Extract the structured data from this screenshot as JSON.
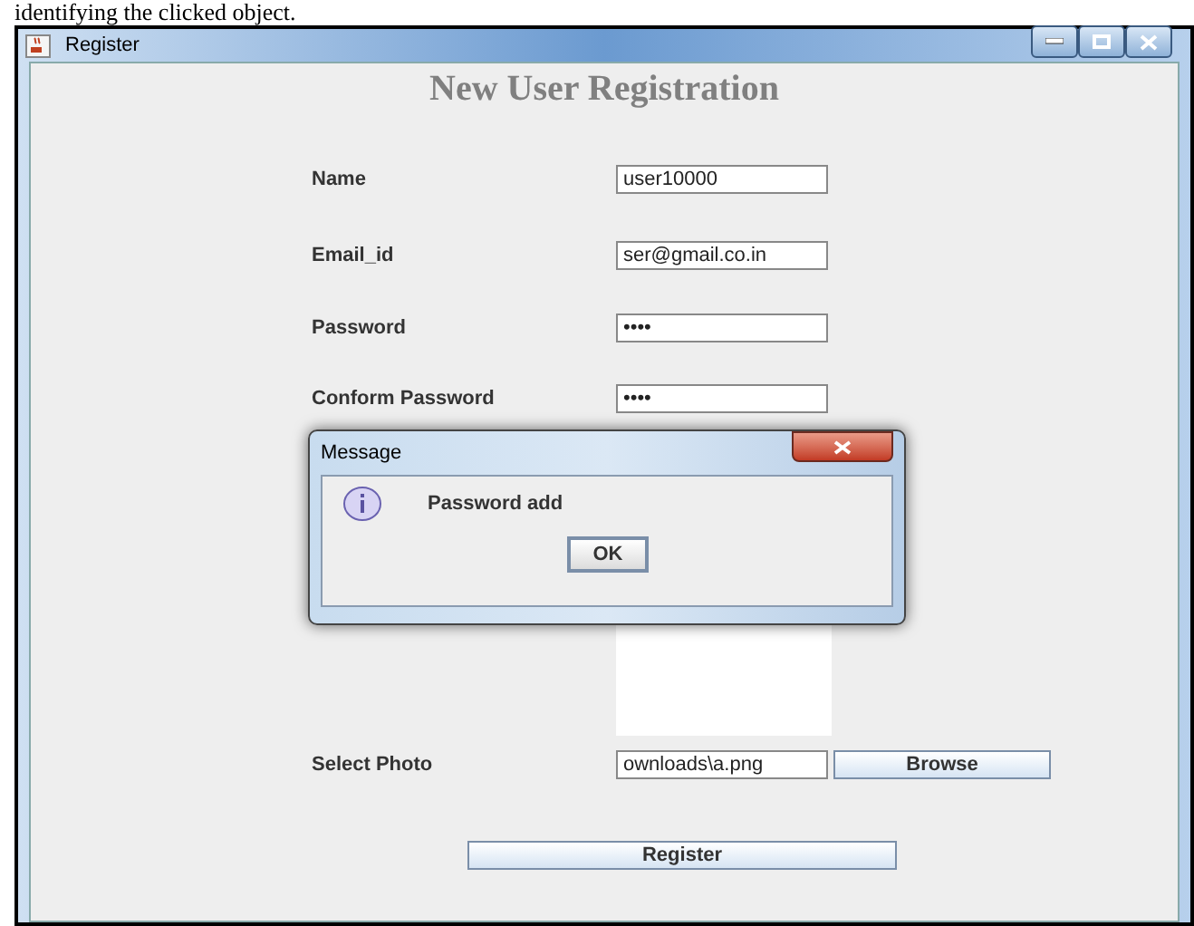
{
  "caption": "identifying the clicked object.",
  "window": {
    "title": "Register"
  },
  "heading": "New User Registration",
  "fields": [
    {
      "label": "Name",
      "value": "user10000"
    },
    {
      "label": "Email_id",
      "value": "ser@gmail.co.in"
    },
    {
      "label": "Password",
      "value": "••••"
    },
    {
      "label": "Conform Password",
      "value": "••••"
    }
  ],
  "photo": {
    "label": "Select Photo",
    "value": "ownloads\\a.png",
    "button": "Browse"
  },
  "register_button": "Register",
  "dialog": {
    "title": "Message",
    "message": "Password add",
    "button": "OK"
  }
}
